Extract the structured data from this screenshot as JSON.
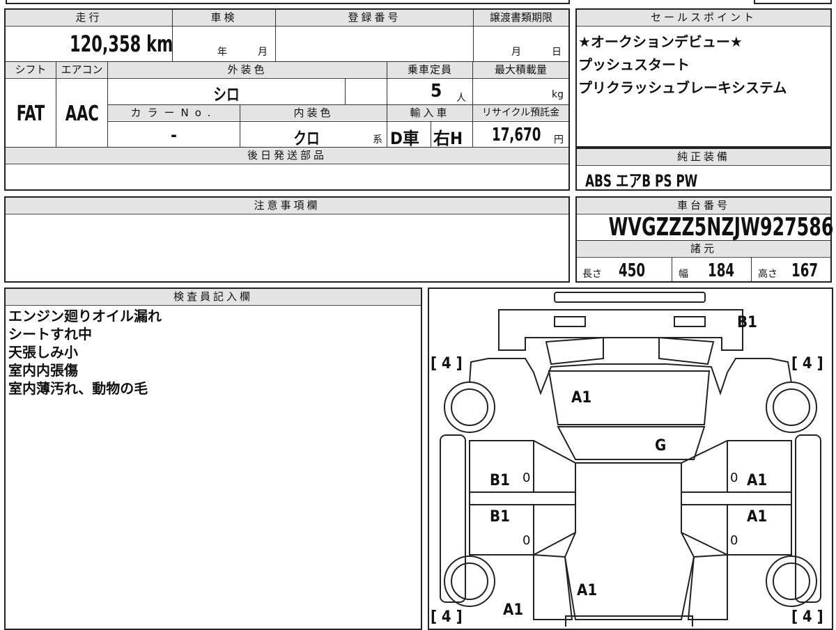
{
  "spec": {
    "mileage_label": "走行",
    "mileage_value": "120,358",
    "mileage_unit": "km",
    "shaken_label": "車検",
    "shaken_year": "年",
    "shaken_month": "月",
    "plate_label": "登録番号",
    "transfer_label": "譲渡書類期限",
    "transfer_month": "月",
    "transfer_day": "日",
    "shift_label": "シフト",
    "shift_value": "FAT",
    "ac_label": "エアコン",
    "ac_value": "AAC",
    "exterior_label": "外装色",
    "exterior_value": "シロ",
    "capacity_label": "乗車定員",
    "capacity_value": "5",
    "capacity_unit": "人",
    "load_label": "最大積載量",
    "load_unit": "kg",
    "color_no_label": "カラーNo.",
    "color_no_value": "-",
    "interior_label": "内装色",
    "interior_value": "クロ",
    "interior_suffix": "系",
    "import_label": "輸入車",
    "import_value": "D車",
    "handle_value": "右H",
    "recycle_label": "リサイクル預託金",
    "recycle_value": "17,670",
    "recycle_unit": "円",
    "later_parts_label": "後日発送部品"
  },
  "sales": {
    "label": "セールスポイント",
    "lines": [
      "★オークションデビュー★",
      "プッシュスタート",
      "プリクラッシュブレーキシステム"
    ]
  },
  "equipment": {
    "label": "純正装備",
    "value": "ABS エアB PS PW"
  },
  "caution": {
    "label": "注意事項欄"
  },
  "chassis": {
    "label": "車台番号",
    "value": "WVGZZZ5NZJW927586",
    "dims_label": "諸元",
    "length_label": "長さ",
    "length_value": "450",
    "width_label": "幅",
    "width_value": "184",
    "height_label": "高さ",
    "height_value": "167"
  },
  "inspector": {
    "label": "検査員記入欄",
    "lines": [
      "エンジン廻りオイル漏れ",
      "シートすれ中",
      "天張しみ小",
      "室内内張傷",
      "室内薄汚れ、動物の毛"
    ]
  },
  "diagram": {
    "tire_fl": "[ 4 ]",
    "tire_fr": "[ 4 ]",
    "tire_rl": "[ 4 ]",
    "tire_rr": "[ 4 ]",
    "rear_bumper": "B1",
    "hood": "A1",
    "windshield": "G",
    "left_front_door": "B1",
    "left_rear_door": "B1",
    "right_front_door": "A1",
    "right_rear_door": "A1",
    "zero_lf": "0",
    "zero_lr": "0",
    "zero_rf": "0",
    "zero_rr": "0",
    "rear_area": "A1",
    "left_rear_quarter": "A1"
  }
}
